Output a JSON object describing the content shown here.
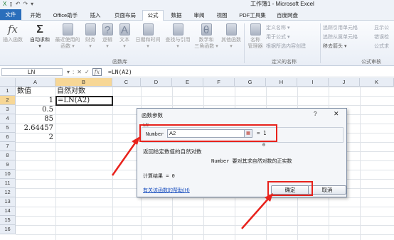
{
  "titlebar": {
    "title": "工作簿1 - Microsoft Excel",
    "qat": [
      "X",
      "▯",
      "↶",
      "↷",
      "▾"
    ]
  },
  "tabs": [
    "文件",
    "开始",
    "Office助手",
    "插入",
    "页面布局",
    "公式",
    "数据",
    "审阅",
    "视图",
    "PDF工具集",
    "百度网盘"
  ],
  "active_tab": "公式",
  "ribbon": {
    "buttons": [
      {
        "icon": "fx-icon",
        "glyph": "fx",
        "label1": "插入函数",
        "label2": ""
      },
      {
        "icon": "sum-icon",
        "glyph": "Σ",
        "label1": "自动求和",
        "label2": "▾"
      },
      {
        "icon": "recent-icon",
        "glyph": "",
        "label1": "最近使用的",
        "label2": "函数 ▾"
      },
      {
        "icon": "finance-icon",
        "glyph": "",
        "label1": "财务",
        "label2": "▾"
      },
      {
        "icon": "logic-icon",
        "glyph": "?",
        "label1": "逻辑",
        "label2": "▾"
      },
      {
        "icon": "text-icon",
        "glyph": "A",
        "label1": "文本",
        "label2": "▾"
      },
      {
        "icon": "datetime-icon",
        "glyph": "",
        "label1": "日期和时间",
        "label2": "▾"
      },
      {
        "icon": "lookup-icon",
        "glyph": "",
        "label1": "查找与引用",
        "label2": "▾"
      },
      {
        "icon": "math-icon",
        "glyph": "θ",
        "label1": "数学和",
        "label2": "三角函数 ▾"
      },
      {
        "icon": "more-icon",
        "glyph": "",
        "label1": "其他函数",
        "label2": "▾"
      },
      {
        "icon": "name-manager-icon",
        "glyph": "",
        "label1": "名称",
        "label2": "管理器"
      }
    ],
    "defined_names": [
      "定义名称 ▾",
      "用于公式 ▾",
      "根据所选内容创建"
    ],
    "audit": [
      "追踪引用单元格",
      "追踪从属单元格",
      "移去箭头 ▾"
    ],
    "audit_right": [
      "显示公",
      "错误检",
      "公式求"
    ],
    "groups": [
      "函数库",
      "定义的名称",
      "公式审核"
    ]
  },
  "formula_bar": {
    "name_box": "LN",
    "buttons": [
      "▾",
      ":",
      "✕",
      "✓"
    ],
    "fx": "fx",
    "content": "=LN(A2)"
  },
  "columns": [
    "A",
    "B",
    "C",
    "D",
    "E",
    "F",
    "G",
    "H",
    "I",
    "J",
    "K"
  ],
  "rows": [
    "1",
    "2",
    "3",
    "4",
    "5",
    "6",
    "7",
    "8",
    "9",
    "10",
    "11",
    "12",
    "13",
    "14",
    "15",
    "16"
  ],
  "selected_row": "2",
  "cells": {
    "a1": "数值",
    "b1": "自然对数",
    "a2": "1",
    "b2": "=LN(A2)",
    "a3": "0.5",
    "a4": "85",
    "a5": "2.64457",
    "a6": "2"
  },
  "dialog": {
    "title": "函数参数",
    "help": "?",
    "close": "✕",
    "function_name": "LN",
    "arg_label": "Number",
    "arg_value": "A2",
    "arg_result": "= 1",
    "result_zero": "0",
    "description": "返回给定数值的自然对数",
    "arg_description": "Number  要对其求自然对数的正实数",
    "calc_result": "计算结果 = 0",
    "help_link": "有关该函数的帮助(H)",
    "ok": "确定",
    "cancel": "取消"
  },
  "colors": {
    "file_tab": "#2a6ebb",
    "selected_header": "#f7d796",
    "highlight": "#e8221c",
    "link": "#1a4fbf"
  }
}
